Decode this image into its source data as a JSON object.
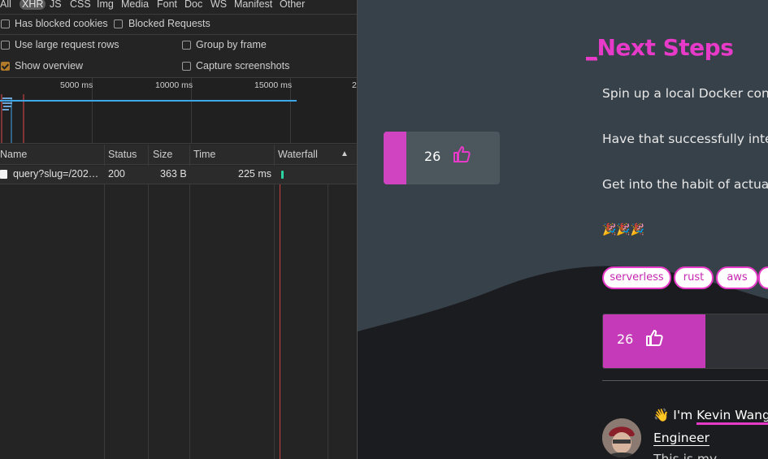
{
  "devtools": {
    "filter_types": [
      "All",
      "XHR",
      "JS",
      "CSS",
      "Img",
      "Media",
      "Font",
      "Doc",
      "WS",
      "Manifest",
      "Other"
    ],
    "options": {
      "has_blocked_cookies": "Has blocked cookies",
      "blocked_requests": "Blocked Requests",
      "use_large_request_rows": "Use large request rows",
      "group_by_frame": "Group by frame",
      "show_overview": "Show overview",
      "capture_screenshots": "Capture screenshots"
    },
    "overview_ticks": [
      "5000 ms",
      "10000 ms",
      "15000 ms"
    ],
    "columns": {
      "name": "Name",
      "status": "Status",
      "size": "Size",
      "time": "Time",
      "waterfall": "Waterfall"
    },
    "requests": [
      {
        "name": "query?slug=/202…",
        "status": "200",
        "size": "363 B",
        "time": "225 ms"
      }
    ],
    "colors": {
      "accent_checkbox": "#b07a2a",
      "timeline_blue": "#3fa6e8",
      "timeline_red": "#e04747",
      "waterfall_green": "#2bd4a0"
    }
  },
  "site": {
    "heading": "Next Steps",
    "heading_prefix": "_",
    "paragraphs": [
      "Spin up a local Docker conta",
      "Have that successfully interf",
      "Get into the habit of actually"
    ],
    "emoji_row": "🎉🎉🎉",
    "tags": [
      "serverless",
      "rust",
      "aws"
    ],
    "like_count_side": "26",
    "like_count_bottom": "26",
    "author": {
      "wave_emoji": "👋",
      "prefix": "I'm",
      "name": "Kevin Wang",
      "suffix": ".",
      "role": "Engineer",
      "partial_line": "This is my..."
    },
    "colors": {
      "brand": "#e83ac8",
      "background": "#374149",
      "dark_band": "#1b1c1f"
    },
    "icons": [
      "thumbs-up-icon"
    ]
  }
}
